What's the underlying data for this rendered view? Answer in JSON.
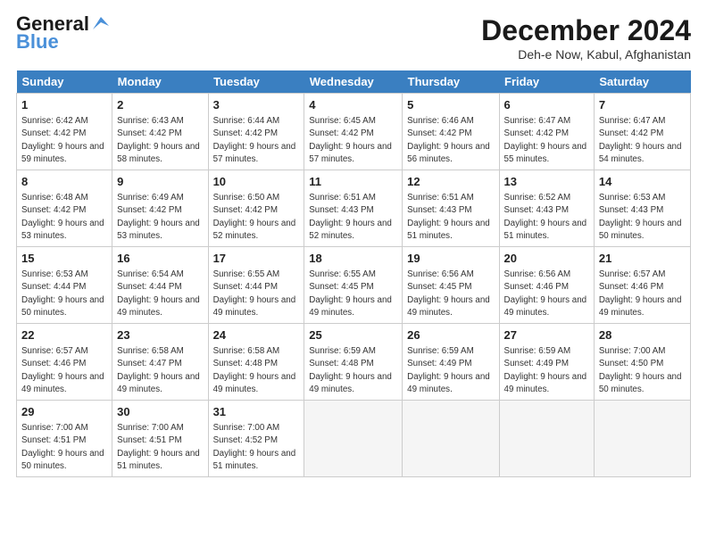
{
  "header": {
    "logo_general": "General",
    "logo_blue": "Blue",
    "title": "December 2024",
    "subtitle": "Deh-e Now, Kabul, Afghanistan"
  },
  "columns": [
    "Sunday",
    "Monday",
    "Tuesday",
    "Wednesday",
    "Thursday",
    "Friday",
    "Saturday"
  ],
  "weeks": [
    [
      {
        "day": "1",
        "sunrise": "6:42 AM",
        "sunset": "4:42 PM",
        "daylight": "9 hours and 59 minutes."
      },
      {
        "day": "2",
        "sunrise": "6:43 AM",
        "sunset": "4:42 PM",
        "daylight": "9 hours and 58 minutes."
      },
      {
        "day": "3",
        "sunrise": "6:44 AM",
        "sunset": "4:42 PM",
        "daylight": "9 hours and 57 minutes."
      },
      {
        "day": "4",
        "sunrise": "6:45 AM",
        "sunset": "4:42 PM",
        "daylight": "9 hours and 57 minutes."
      },
      {
        "day": "5",
        "sunrise": "6:46 AM",
        "sunset": "4:42 PM",
        "daylight": "9 hours and 56 minutes."
      },
      {
        "day": "6",
        "sunrise": "6:47 AM",
        "sunset": "4:42 PM",
        "daylight": "9 hours and 55 minutes."
      },
      {
        "day": "7",
        "sunrise": "6:47 AM",
        "sunset": "4:42 PM",
        "daylight": "9 hours and 54 minutes."
      }
    ],
    [
      {
        "day": "8",
        "sunrise": "6:48 AM",
        "sunset": "4:42 PM",
        "daylight": "9 hours and 53 minutes."
      },
      {
        "day": "9",
        "sunrise": "6:49 AM",
        "sunset": "4:42 PM",
        "daylight": "9 hours and 53 minutes."
      },
      {
        "day": "10",
        "sunrise": "6:50 AM",
        "sunset": "4:42 PM",
        "daylight": "9 hours and 52 minutes."
      },
      {
        "day": "11",
        "sunrise": "6:51 AM",
        "sunset": "4:43 PM",
        "daylight": "9 hours and 52 minutes."
      },
      {
        "day": "12",
        "sunrise": "6:51 AM",
        "sunset": "4:43 PM",
        "daylight": "9 hours and 51 minutes."
      },
      {
        "day": "13",
        "sunrise": "6:52 AM",
        "sunset": "4:43 PM",
        "daylight": "9 hours and 51 minutes."
      },
      {
        "day": "14",
        "sunrise": "6:53 AM",
        "sunset": "4:43 PM",
        "daylight": "9 hours and 50 minutes."
      }
    ],
    [
      {
        "day": "15",
        "sunrise": "6:53 AM",
        "sunset": "4:44 PM",
        "daylight": "9 hours and 50 minutes."
      },
      {
        "day": "16",
        "sunrise": "6:54 AM",
        "sunset": "4:44 PM",
        "daylight": "9 hours and 49 minutes."
      },
      {
        "day": "17",
        "sunrise": "6:55 AM",
        "sunset": "4:44 PM",
        "daylight": "9 hours and 49 minutes."
      },
      {
        "day": "18",
        "sunrise": "6:55 AM",
        "sunset": "4:45 PM",
        "daylight": "9 hours and 49 minutes."
      },
      {
        "day": "19",
        "sunrise": "6:56 AM",
        "sunset": "4:45 PM",
        "daylight": "9 hours and 49 minutes."
      },
      {
        "day": "20",
        "sunrise": "6:56 AM",
        "sunset": "4:46 PM",
        "daylight": "9 hours and 49 minutes."
      },
      {
        "day": "21",
        "sunrise": "6:57 AM",
        "sunset": "4:46 PM",
        "daylight": "9 hours and 49 minutes."
      }
    ],
    [
      {
        "day": "22",
        "sunrise": "6:57 AM",
        "sunset": "4:46 PM",
        "daylight": "9 hours and 49 minutes."
      },
      {
        "day": "23",
        "sunrise": "6:58 AM",
        "sunset": "4:47 PM",
        "daylight": "9 hours and 49 minutes."
      },
      {
        "day": "24",
        "sunrise": "6:58 AM",
        "sunset": "4:48 PM",
        "daylight": "9 hours and 49 minutes."
      },
      {
        "day": "25",
        "sunrise": "6:59 AM",
        "sunset": "4:48 PM",
        "daylight": "9 hours and 49 minutes."
      },
      {
        "day": "26",
        "sunrise": "6:59 AM",
        "sunset": "4:49 PM",
        "daylight": "9 hours and 49 minutes."
      },
      {
        "day": "27",
        "sunrise": "6:59 AM",
        "sunset": "4:49 PM",
        "daylight": "9 hours and 49 minutes."
      },
      {
        "day": "28",
        "sunrise": "7:00 AM",
        "sunset": "4:50 PM",
        "daylight": "9 hours and 50 minutes."
      }
    ],
    [
      {
        "day": "29",
        "sunrise": "7:00 AM",
        "sunset": "4:51 PM",
        "daylight": "9 hours and 50 minutes."
      },
      {
        "day": "30",
        "sunrise": "7:00 AM",
        "sunset": "4:51 PM",
        "daylight": "9 hours and 51 minutes."
      },
      {
        "day": "31",
        "sunrise": "7:00 AM",
        "sunset": "4:52 PM",
        "daylight": "9 hours and 51 minutes."
      },
      null,
      null,
      null,
      null
    ]
  ]
}
